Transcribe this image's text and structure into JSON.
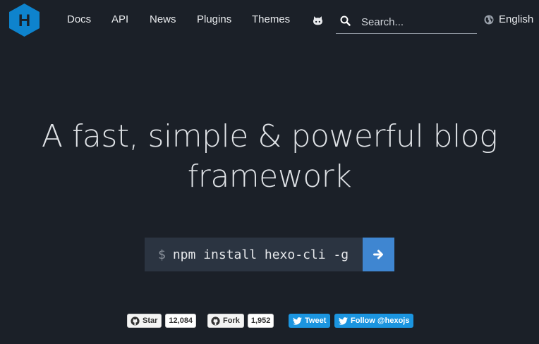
{
  "header": {
    "nav": [
      "Docs",
      "API",
      "News",
      "Plugins",
      "Themes"
    ],
    "search": {
      "placeholder": "Search..."
    },
    "language": "English",
    "logo_letter": "H"
  },
  "hero": {
    "title_line1": "A fast, simple & powerful blog",
    "title_line2": "framework"
  },
  "install": {
    "prompt": "$",
    "command": "npm install hexo-cli -g"
  },
  "social": {
    "star_label": "Star",
    "star_count": "12,084",
    "fork_label": "Fork",
    "fork_count": "1,952",
    "tweet_label": "Tweet",
    "follow_label": "Follow @hexojs"
  },
  "colors": {
    "background": "#1b2028",
    "accent": "#3f86d1",
    "logo": "#0e83cd",
    "twitter": "#1b95e0"
  },
  "icons": [
    "hexo-logo",
    "github-icon",
    "search-icon",
    "globe-icon",
    "arrow-right-icon",
    "twitter-icon"
  ]
}
